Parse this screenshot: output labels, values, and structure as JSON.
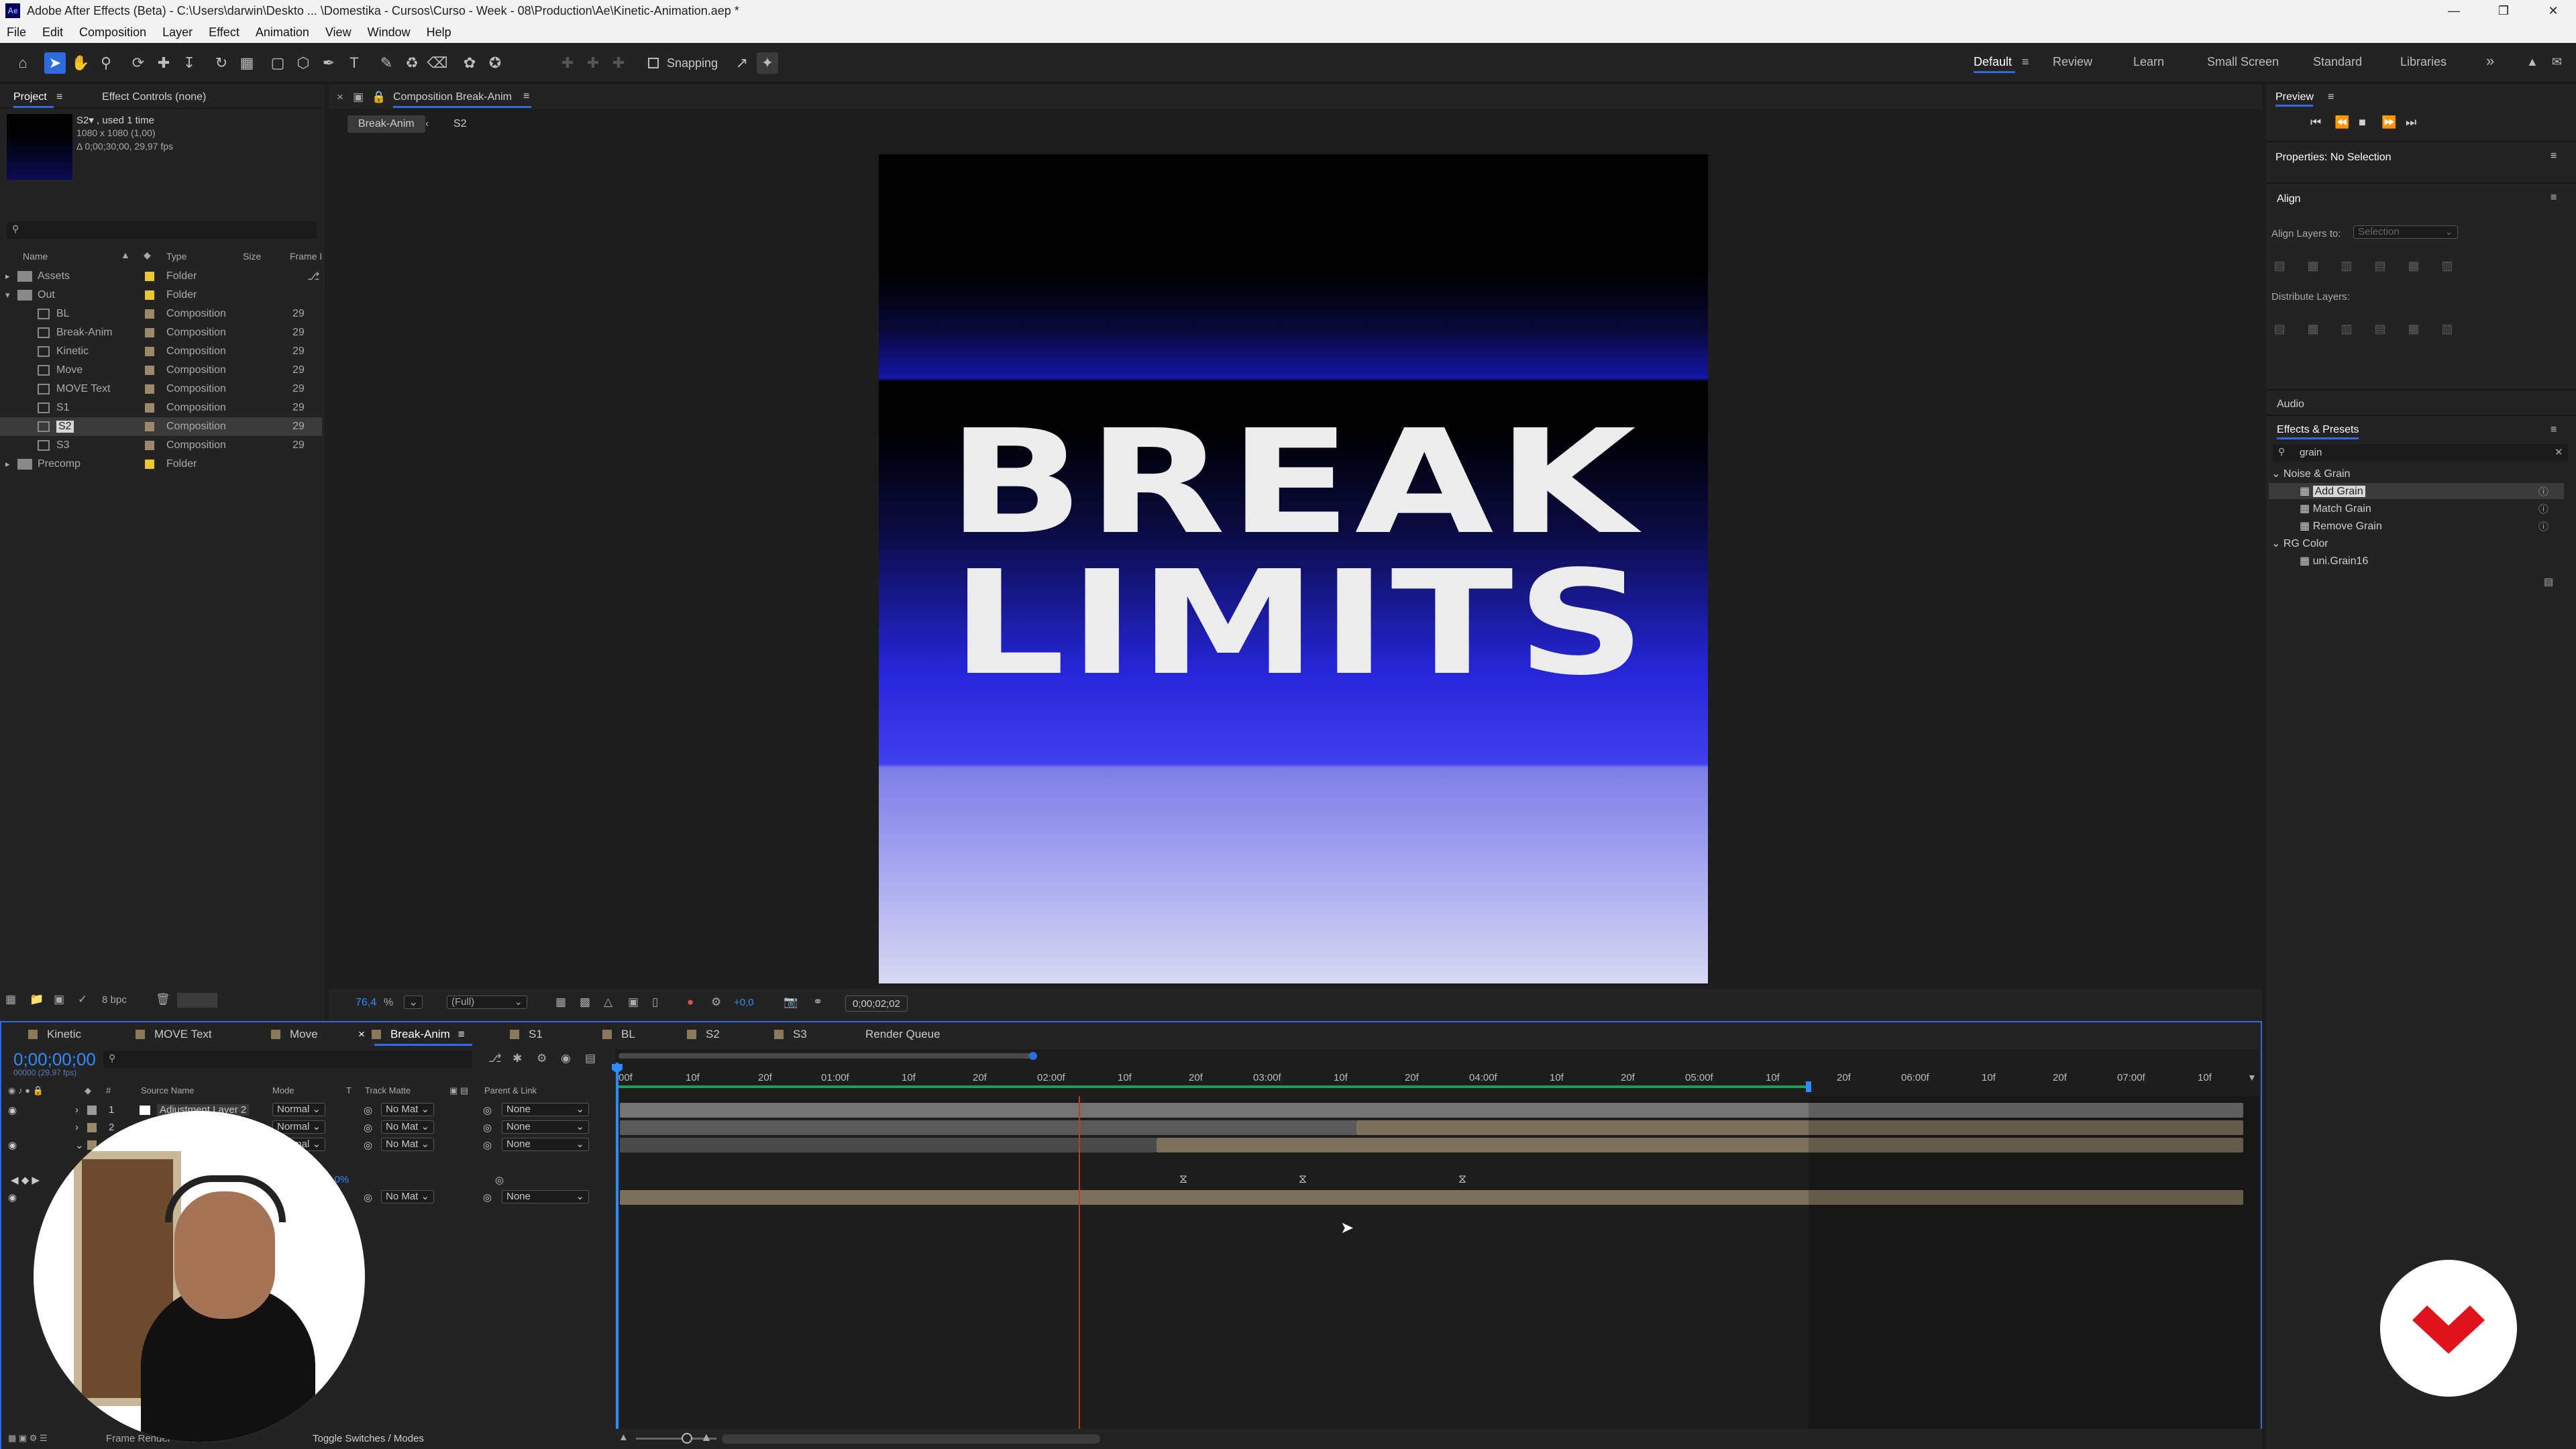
{
  "window": {
    "title": "Adobe After Effects (Beta) - C:\\Users\\darwin\\Deskto ... \\Domestika - Cursos\\Curso - Week - 08\\Production\\Ae\\Kinetic-Animation.aep *",
    "app_icon": "Ae"
  },
  "menu": [
    "File",
    "Edit",
    "Composition",
    "Layer",
    "Effect",
    "Animation",
    "View",
    "Window",
    "Help"
  ],
  "toolbar": {
    "snapping_label": "Snapping"
  },
  "workspaces": [
    "Default",
    "Review",
    "Learn",
    "Small Screen",
    "Standard",
    "Libraries"
  ],
  "project": {
    "tab_project": "Project",
    "tab_effect_controls": "Effect Controls (none)",
    "selected_name": "S2▾ , used 1 time",
    "selected_dims": "1080 x 1080 (1,00)",
    "selected_duration": "Δ 0;00;30;00, 29,97 fps",
    "columns": {
      "name": "Name",
      "type": "Type",
      "size": "Size",
      "frame": "Frame I"
    },
    "items": [
      {
        "name": "Assets",
        "type": "Folder",
        "frame": ""
      },
      {
        "name": "Out",
        "type": "Folder",
        "frame": ""
      },
      {
        "name": "BL",
        "type": "Composition",
        "frame": "29"
      },
      {
        "name": "Break-Anim",
        "type": "Composition",
        "frame": "29"
      },
      {
        "name": "Kinetic",
        "type": "Composition",
        "frame": "29"
      },
      {
        "name": "Move",
        "type": "Composition",
        "frame": "29"
      },
      {
        "name": "MOVE Text",
        "type": "Composition",
        "frame": "29"
      },
      {
        "name": "S1",
        "type": "Composition",
        "frame": "29"
      },
      {
        "name": "S2",
        "type": "Composition",
        "frame": "29"
      },
      {
        "name": "S3",
        "type": "Composition",
        "frame": "29"
      },
      {
        "name": "Precomp",
        "type": "Folder",
        "frame": ""
      }
    ],
    "bpc": "8 bpc"
  },
  "comp": {
    "panel_title": "Composition Break-Anim",
    "breadcrumb": [
      "Break-Anim",
      "S2"
    ],
    "headline": [
      "BREAK",
      "LIMITS"
    ],
    "zoom": "76,4",
    "zoom_unit": "%",
    "resolution": "(Full)",
    "exposure": "+0,0",
    "timecode": "0;00;02;02"
  },
  "timeline": {
    "tabs": [
      "Kinetic",
      "MOVE Text",
      "Move",
      "Break-Anim",
      "S1",
      "BL",
      "S2",
      "S3",
      "Render Queue"
    ],
    "timecode": "0;00;00;00",
    "timecode_sub": "00000 (29.97 fps)",
    "columns": {
      "source": "Source Name",
      "mode": "Mode",
      "t": "T",
      "matte": "Track Matte",
      "parent": "Parent & Link"
    },
    "layers": [
      {
        "num": "1",
        "name": "Adjustment Layer 2",
        "mode": "Normal",
        "matte": "No Mat",
        "parent": "None"
      },
      {
        "num": "2",
        "name": "",
        "mode": "Normal",
        "matte": "No Mat",
        "parent": "None"
      },
      {
        "num": "3",
        "name": "",
        "mode": "Normal",
        "matte": "No Mat",
        "parent": "None"
      },
      {
        "num": "",
        "name": "",
        "mode": "",
        "matte": "No Mat",
        "parent": "None"
      }
    ],
    "prop_value": "0,0%",
    "ruler": [
      "00f",
      "10f",
      "20f",
      "01:00f",
      "10f",
      "20f",
      "02:00f",
      "10f",
      "20f",
      "03:00f",
      "10f",
      "20f",
      "04:00f",
      "10f",
      "20f",
      "05:00f",
      "10f",
      "20f",
      "06:00f",
      "10f",
      "20f",
      "07:00f",
      "10f"
    ],
    "footer_left": "Frame Render",
    "footer_toggle": "Toggle Switches / Modes"
  },
  "right": {
    "preview_title": "Preview",
    "properties_title": "Properties: No Selection",
    "align_title": "Align",
    "align_layers_to": "Align Layers to:",
    "align_target": "Selection",
    "distribute_layers": "Distribute Layers:",
    "audio_title": "Audio",
    "effects_title": "Effects & Presets",
    "effects_search": "grain",
    "effects_tree": [
      {
        "label": "Noise & Grain",
        "level": 0
      },
      {
        "label": "Add Grain",
        "level": 1,
        "selected": true
      },
      {
        "label": "Match Grain",
        "level": 1
      },
      {
        "label": "Remove Grain",
        "level": 1
      },
      {
        "label": "RG Color",
        "level": 0
      },
      {
        "label": "uni.Grain16",
        "level": 1
      }
    ]
  },
  "colors": {
    "accent": "#2d6be0",
    "timecode": "#2d8cff",
    "playhead": "#c0392b",
    "brand": "#e0131d"
  }
}
